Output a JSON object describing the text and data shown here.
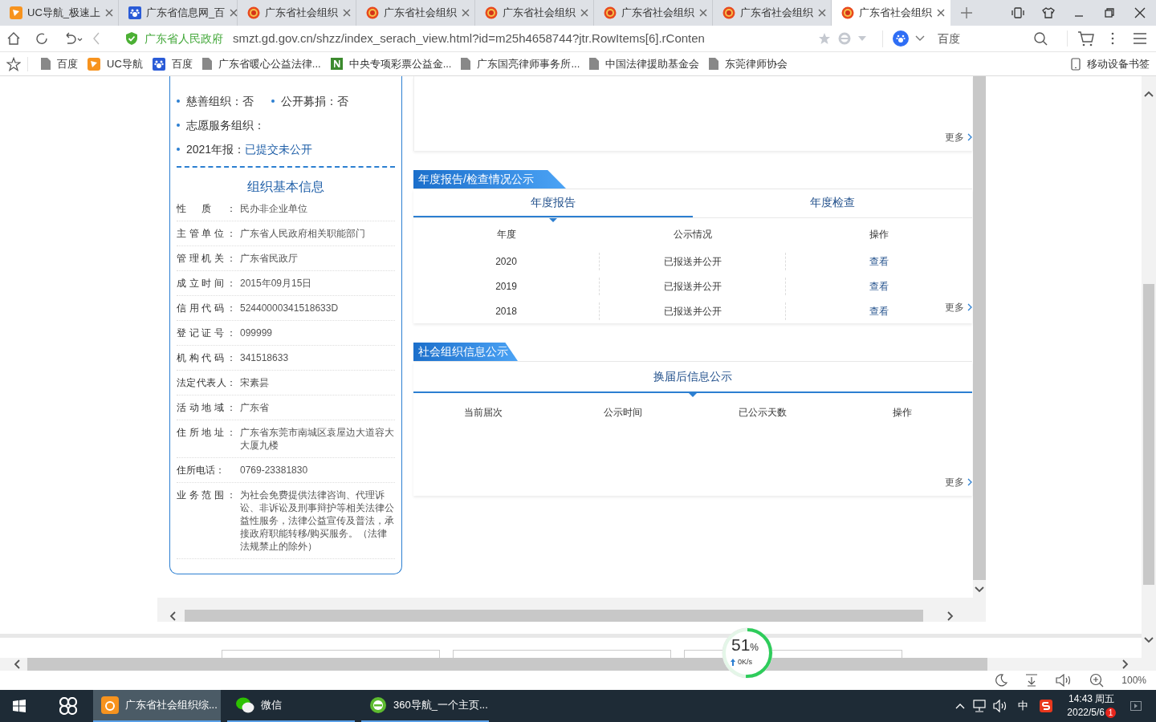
{
  "browser": {
    "tabs": [
      {
        "title": "UC导航_极速上",
        "selected": false
      },
      {
        "title": "广东省信息网_百",
        "selected": false
      },
      {
        "title": "广东省社会组织",
        "selected": false
      },
      {
        "title": "广东省社会组织",
        "selected": false
      },
      {
        "title": "广东省社会组织",
        "selected": false
      },
      {
        "title": "广东省社会组织",
        "selected": false
      },
      {
        "title": "广东省社会组织",
        "selected": false
      },
      {
        "title": "广东省社会组织",
        "selected": true
      }
    ],
    "site_label": "广东省人民政府",
    "url": "smzt.gd.gov.cn/shzz/index_serach_view.html?id=m25h4658744?jtr.RowItems[6].rConten",
    "search_placeholder": "百度",
    "bookmarks": [
      "百度",
      "UC导航",
      "百度",
      "广东省暖心公益法律...",
      "中央专项彩票公益金...",
      "广东国亮律师事务所...",
      "中国法律援助基金会",
      "东莞律师协会"
    ],
    "mobile_bookmarks": "移动设备书签"
  },
  "page": {
    "summary": [
      [
        {
          "label": "慈善组织：",
          "value": "否",
          "highlight": false
        },
        {
          "label": "公开募捐：",
          "value": "否",
          "highlight": false
        }
      ],
      [
        {
          "label": "志愿服务组织："
        }
      ],
      [
        {
          "label": "2021年报：",
          "value": "已提交未公开",
          "highlight": true
        }
      ]
    ],
    "basic_info": {
      "title": "组织基本信息",
      "rows": [
        {
          "label": "性质：",
          "value": "民办非企业单位",
          "justified": true
        },
        {
          "label": "主管单位：",
          "value": "广东省人民政府相关职能部门",
          "justified": true
        },
        {
          "label": "管理机关：",
          "value": "广东省民政厅",
          "justified": true
        },
        {
          "label": "成立时间：",
          "value": "2015年09月15日",
          "justified": true
        },
        {
          "label": "信用代码：",
          "value": "52440000341518633D",
          "justified": true
        },
        {
          "label": "登记证号：",
          "value": "099999",
          "justified": true
        },
        {
          "label": "机构代码：",
          "value": "341518633",
          "justified": true
        },
        {
          "label": "法定代表人：",
          "value": "宋素昙",
          "justified": true
        },
        {
          "label": "活动地域：",
          "value": "广东省",
          "justified": true
        },
        {
          "label": "住所地址：",
          "value": "广东省东莞市南城区袁屋边大道容大大厦九楼",
          "justified": true
        },
        {
          "label": "住所电话：",
          "value": "0769-23381830",
          "justified": false
        },
        {
          "label": "业务范围：",
          "value": "为社会免费提供法律咨询、代理诉讼、非诉讼及刑事辩护等相关法律公益性服务，法律公益宣传及普法，承接政府职能转移/购买服务。（法律法规禁止的除外）",
          "justified": true
        }
      ]
    },
    "top_card": {
      "more": "更多"
    },
    "annual": {
      "title": "年度报告/检查情况公示",
      "tabs": [
        {
          "label": "年度报告",
          "selected": true
        },
        {
          "label": "年度检查",
          "selected": false
        }
      ],
      "columns": [
        "年度",
        "公示情况",
        "操作"
      ],
      "rows": [
        {
          "year": "2020",
          "status": "已报送并公开",
          "action": "查看"
        },
        {
          "year": "2019",
          "status": "已报送并公开",
          "action": "查看"
        },
        {
          "year": "2018",
          "status": "已报送并公开",
          "action": "查看"
        }
      ],
      "more": "更多"
    },
    "info": {
      "title": "社会组织信息公示",
      "tabs": [
        {
          "label": "换届后信息公示",
          "selected": true
        }
      ],
      "columns": [
        "当前届次",
        "公示时间",
        "已公示天数",
        "操作"
      ],
      "more": "更多"
    }
  },
  "speed_widget": {
    "percent": "51",
    "unit": "%",
    "speed": "0K/s",
    "level": 0.51
  },
  "status_bar": {
    "zoom": "100%"
  },
  "taskbar": {
    "apps": [
      {
        "label": "广东省社会组织综...",
        "selected": true
      },
      {
        "label": "微信",
        "selected": false
      },
      {
        "label": "360导航_一个主页...",
        "selected": false
      }
    ],
    "ime": "中",
    "time": "14:43 周五",
    "date": "2022/5/6",
    "badge": "1"
  }
}
